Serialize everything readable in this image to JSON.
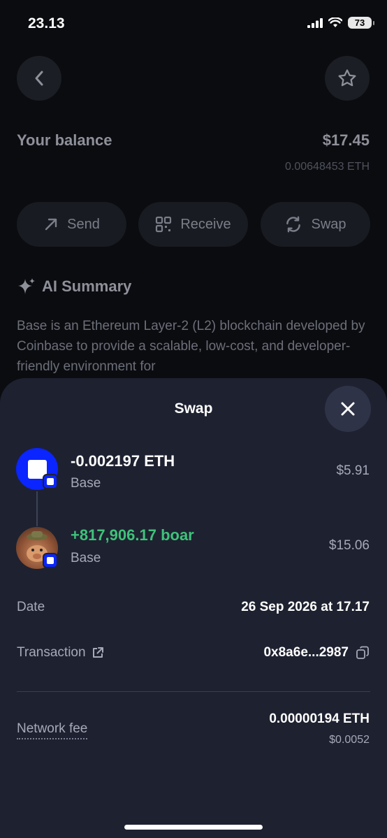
{
  "status_bar": {
    "time": "23.13",
    "battery": "73"
  },
  "background_page": {
    "balance_label": "Your balance",
    "balance_usd": "$17.45",
    "balance_eth": "0.00648453 ETH",
    "actions": {
      "send": "Send",
      "receive": "Receive",
      "swap": "Swap"
    },
    "ai_summary_title": "AI Summary",
    "ai_summary_text": "Base is an Ethereum Layer-2 (L2) blockchain developed by Coinbase to provide a scalable, low-cost, and developer-friendly environment for"
  },
  "sheet": {
    "title": "Swap",
    "from": {
      "amount": "-0.002197 ETH",
      "chain": "Base",
      "usd": "$5.91"
    },
    "to": {
      "amount": "+817,906.17 boar",
      "chain": "Base",
      "usd": "$15.06"
    },
    "date_label": "Date",
    "date_value": "26 Sep 2026 at 17.17",
    "transaction_label": "Transaction",
    "transaction_value": "0x8a6e...2987",
    "network_fee_label": "Network fee",
    "network_fee_eth": "0.00000194 ETH",
    "network_fee_usd": "$0.0052"
  },
  "colors": {
    "positive": "#3ec27a",
    "sheet_bg": "#1e2130",
    "base_blue": "#0a25ff"
  },
  "icons": [
    "back-icon",
    "star-icon",
    "send-arrow-icon",
    "qr-icon",
    "swap-icon",
    "sparkle-icon",
    "close-icon",
    "external-link-icon",
    "copy-icon"
  ]
}
